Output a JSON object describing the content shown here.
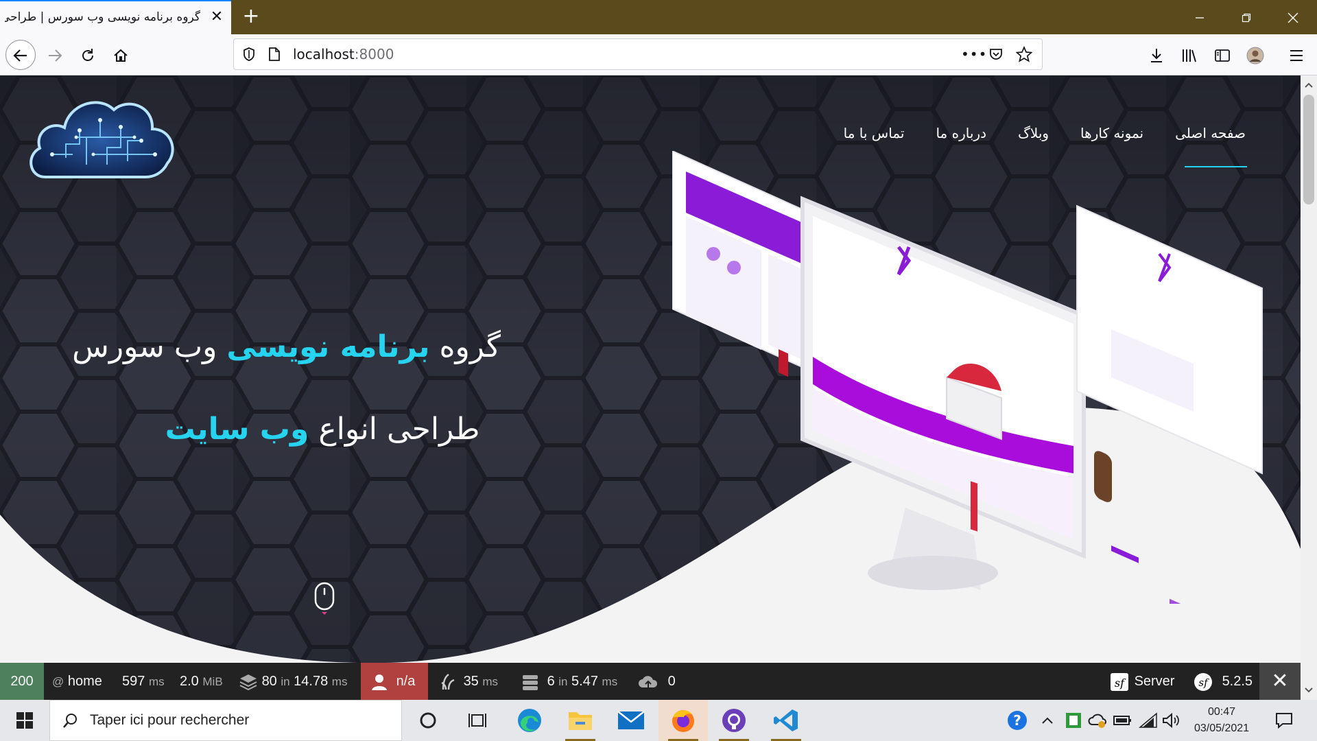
{
  "browser": {
    "tab_title": "گروه برنامه نویسی وب سورس | طراحی",
    "new_tab": "+",
    "url_host": "localhost",
    "url_port": ":8000",
    "page_actions": "•••"
  },
  "site": {
    "nav": [
      "صفحه اصلی",
      "نمونه کارها",
      "وبلاگ",
      "درباره ما",
      "تماس با ما"
    ],
    "headline1_pre": "گروه ",
    "headline1_hl": "برنامه نویسی",
    "headline1_post": " وب سورس",
    "headline2_pre": "طراحی انواع ",
    "headline2_hl": "وب سایت"
  },
  "profiler": {
    "status": "200",
    "route_at": "@",
    "route": "home",
    "time": "597",
    "time_unit": "ms",
    "memory": "2.0",
    "memory_unit": "MiB",
    "events": "80",
    "events_in": "in",
    "events_time": "14.78",
    "events_unit": "ms",
    "user": "n/a",
    "render": "35",
    "render_unit": "ms",
    "queries": "6",
    "queries_in": "in",
    "queries_time": "5.47",
    "queries_unit": "ms",
    "uploads": "0",
    "server_label": "Server",
    "symfony_version": "5.2.5"
  },
  "taskbar": {
    "search_placeholder": "Taper ici pour rechercher",
    "time": "00:47",
    "date": "03/05/2021"
  },
  "colors": {
    "accent": "#27d4f0",
    "titlebar": "#5b4a1c",
    "profiler_ok": "#4f805d",
    "profiler_user": "#b0413e"
  }
}
